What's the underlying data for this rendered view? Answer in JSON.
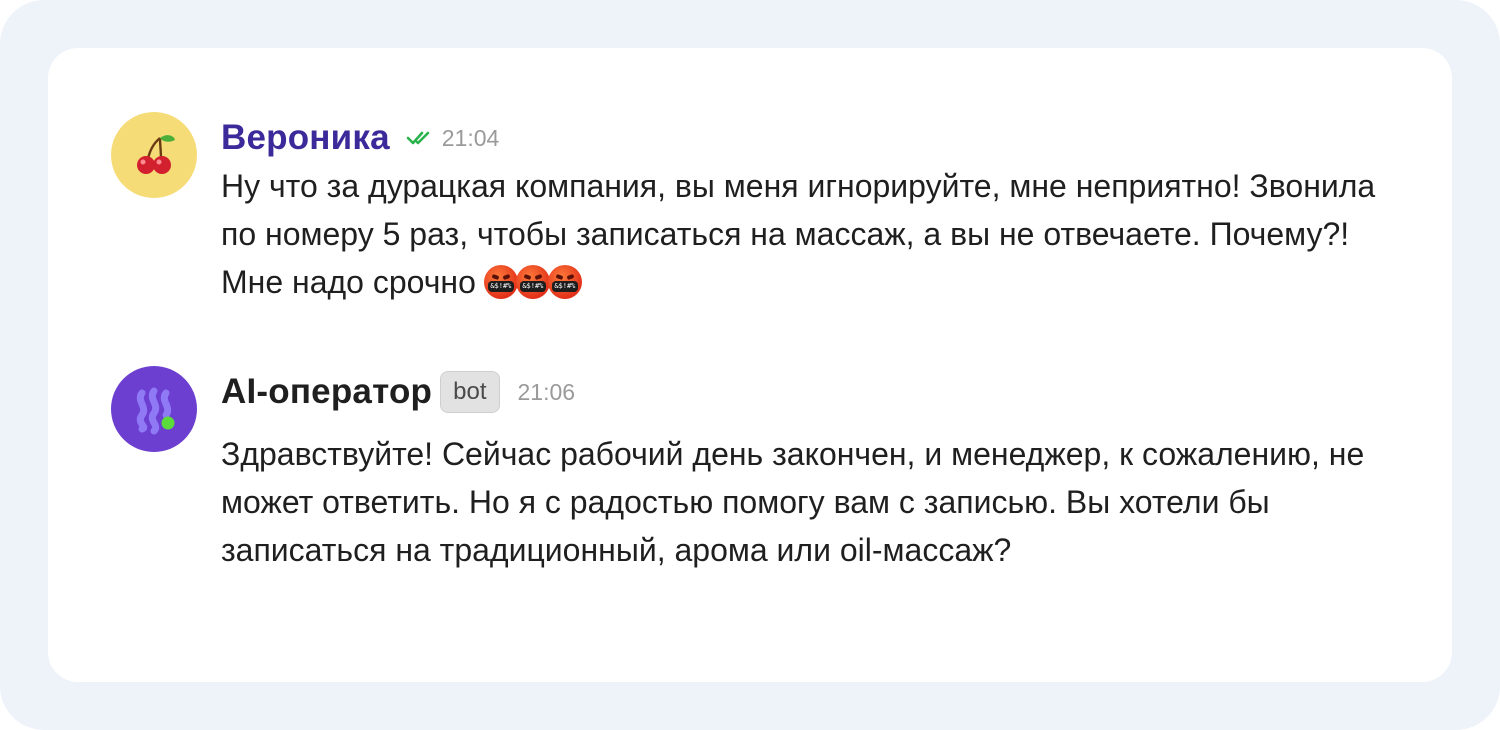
{
  "messages": [
    {
      "sender": "Вероника",
      "time": "21:04",
      "avatar_icon": "cherry-icon",
      "status_icon": "double-check-icon",
      "text": "Ну что за дурацкая компания, вы меня игнорируйте, мне неприятно! Звонила по номеру 5 раз, чтобы записаться на массаж, а вы не отвечаете. Почему?! Мне надо срочно",
      "emoji_mouth_text": "&$!#%",
      "emoji_count": 3
    },
    {
      "sender": "AI-оператор",
      "badge": "bot",
      "time": "21:06",
      "avatar_icon": "ai-bot-logo-icon",
      "text": "Здравствуйте! Сейчас рабочий день закончен, и менеджер, к сожалению, не может ответить. Но я с радостью помогу вам с записью. Вы хотели бы записаться на традиционный, арома или oil-массаж?"
    }
  ],
  "colors": {
    "background": "#eef3fa",
    "card": "#ffffff",
    "user_name": "#3c2a9a",
    "read_check": "#2bb24c",
    "avatar_cherry_bg": "#f5dc77",
    "avatar_bot_bg": "#6c3fd0",
    "bot_dot": "#5cdc3a"
  }
}
